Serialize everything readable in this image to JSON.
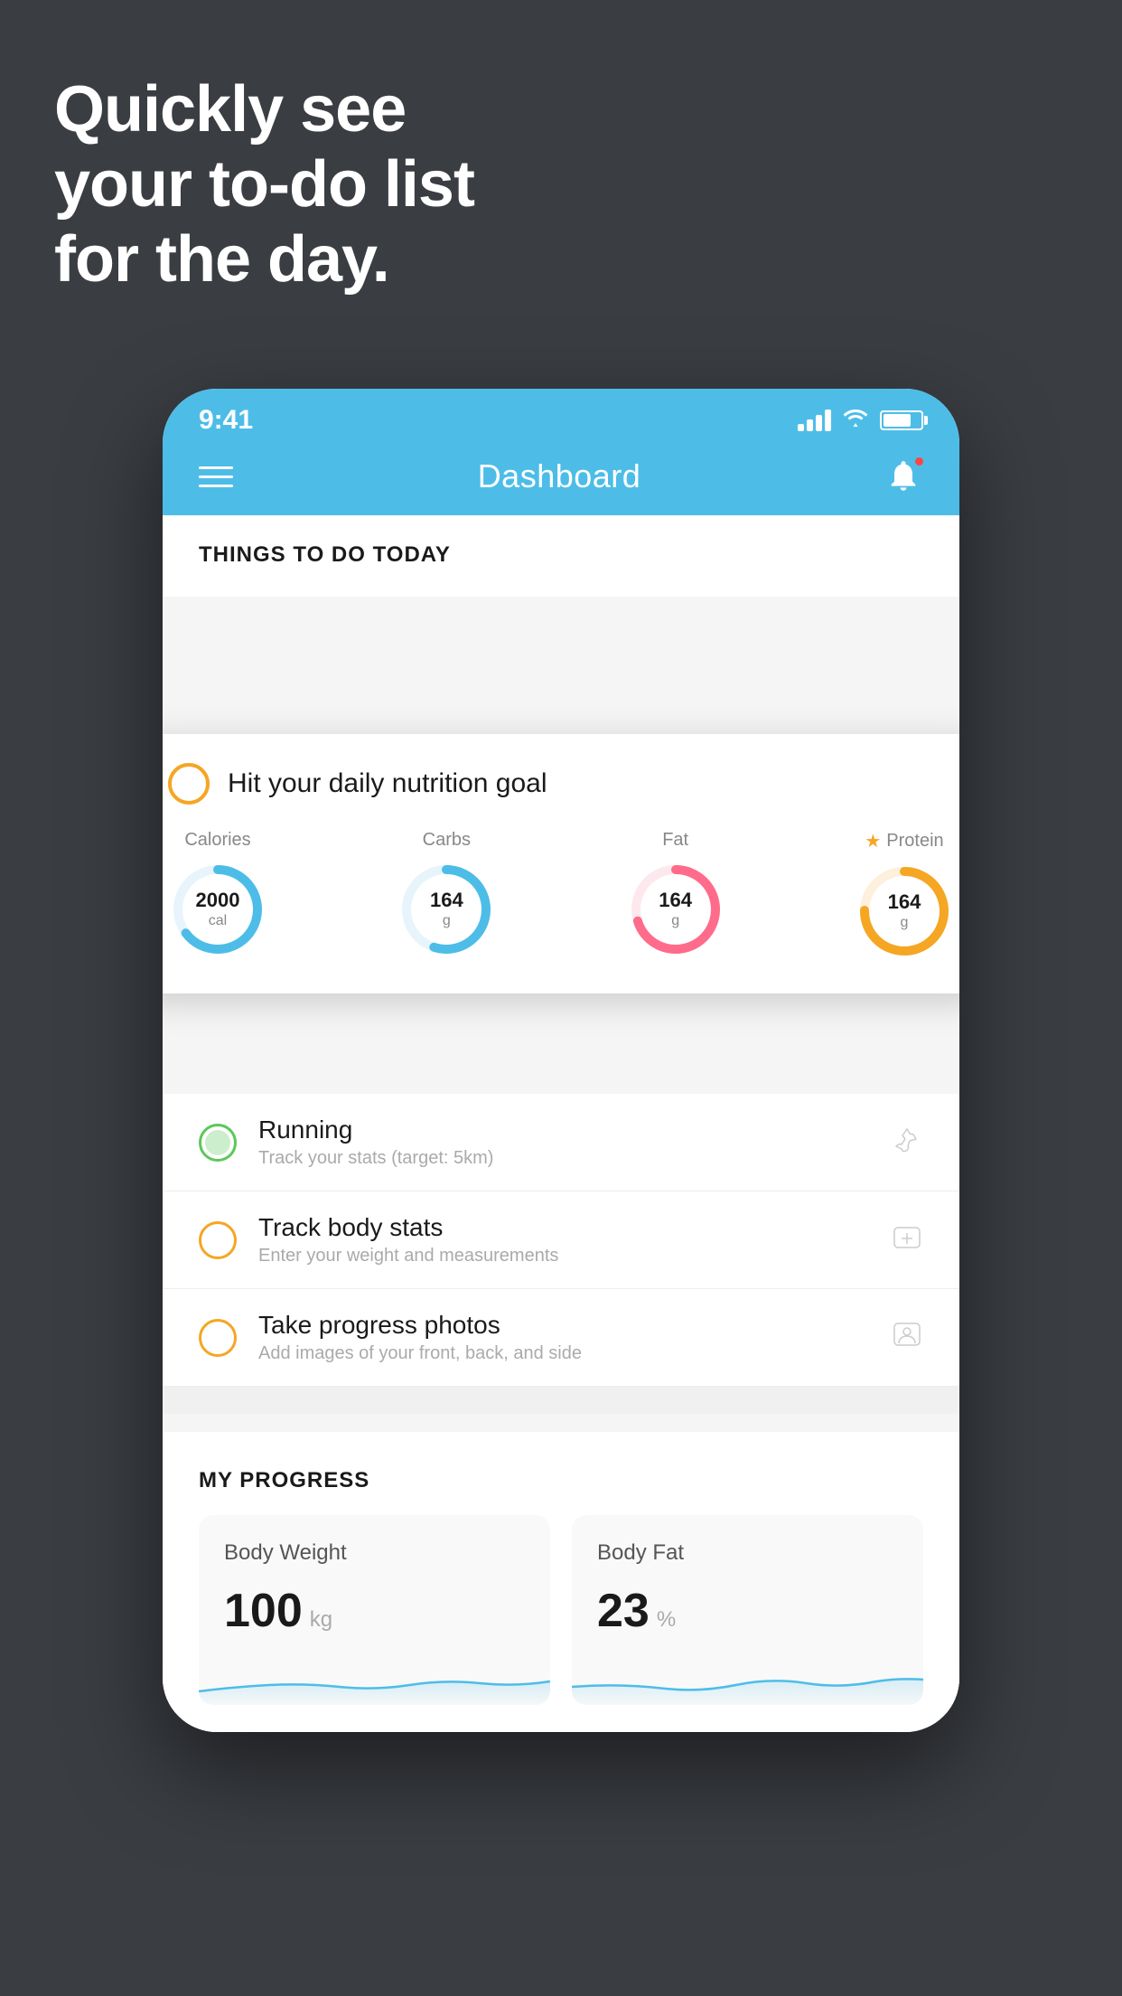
{
  "hero": {
    "line1": "Quickly see",
    "line2": "your to-do list",
    "line3": "for the day."
  },
  "status_bar": {
    "time": "9:41"
  },
  "header": {
    "title": "Dashboard"
  },
  "things_today": {
    "section_title": "THINGS TO DO TODAY"
  },
  "floating_card": {
    "goal_text": "Hit your daily nutrition goal",
    "items": [
      {
        "label": "Calories",
        "value": "2000",
        "unit": "cal",
        "color": "#4dbde8",
        "pct": 65
      },
      {
        "label": "Carbs",
        "value": "164",
        "unit": "g",
        "color": "#4dbde8",
        "pct": 55
      },
      {
        "label": "Fat",
        "value": "164",
        "unit": "g",
        "color": "#ff6b8a",
        "pct": 70
      },
      {
        "label": "Protein",
        "value": "164",
        "unit": "g",
        "color": "#f5a623",
        "pct": 75,
        "starred": true
      }
    ]
  },
  "todo_items": [
    {
      "title": "Running",
      "subtitle": "Track your stats (target: 5km)",
      "circle_type": "green",
      "icon": "shoe"
    },
    {
      "title": "Track body stats",
      "subtitle": "Enter your weight and measurements",
      "circle_type": "yellow",
      "icon": "scale"
    },
    {
      "title": "Take progress photos",
      "subtitle": "Add images of your front, back, and side",
      "circle_type": "yellow",
      "icon": "person"
    }
  ],
  "my_progress": {
    "section_title": "MY PROGRESS",
    "cards": [
      {
        "title": "Body Weight",
        "value": "100",
        "unit": "kg"
      },
      {
        "title": "Body Fat",
        "value": "23",
        "unit": "%"
      }
    ]
  }
}
